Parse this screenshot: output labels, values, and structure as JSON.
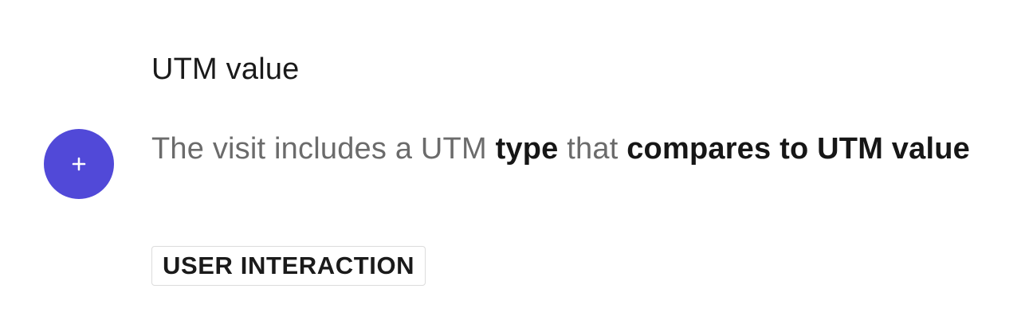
{
  "item": {
    "title": "UTM value",
    "description": {
      "part1": "The visit includes a UTM ",
      "keyword1": "type",
      "part2": " that ",
      "keyword2": "compares to UTM value"
    },
    "badge": "USER INTERACTION"
  },
  "add_button": {
    "icon": "plus-icon",
    "color": "#5149d8"
  }
}
